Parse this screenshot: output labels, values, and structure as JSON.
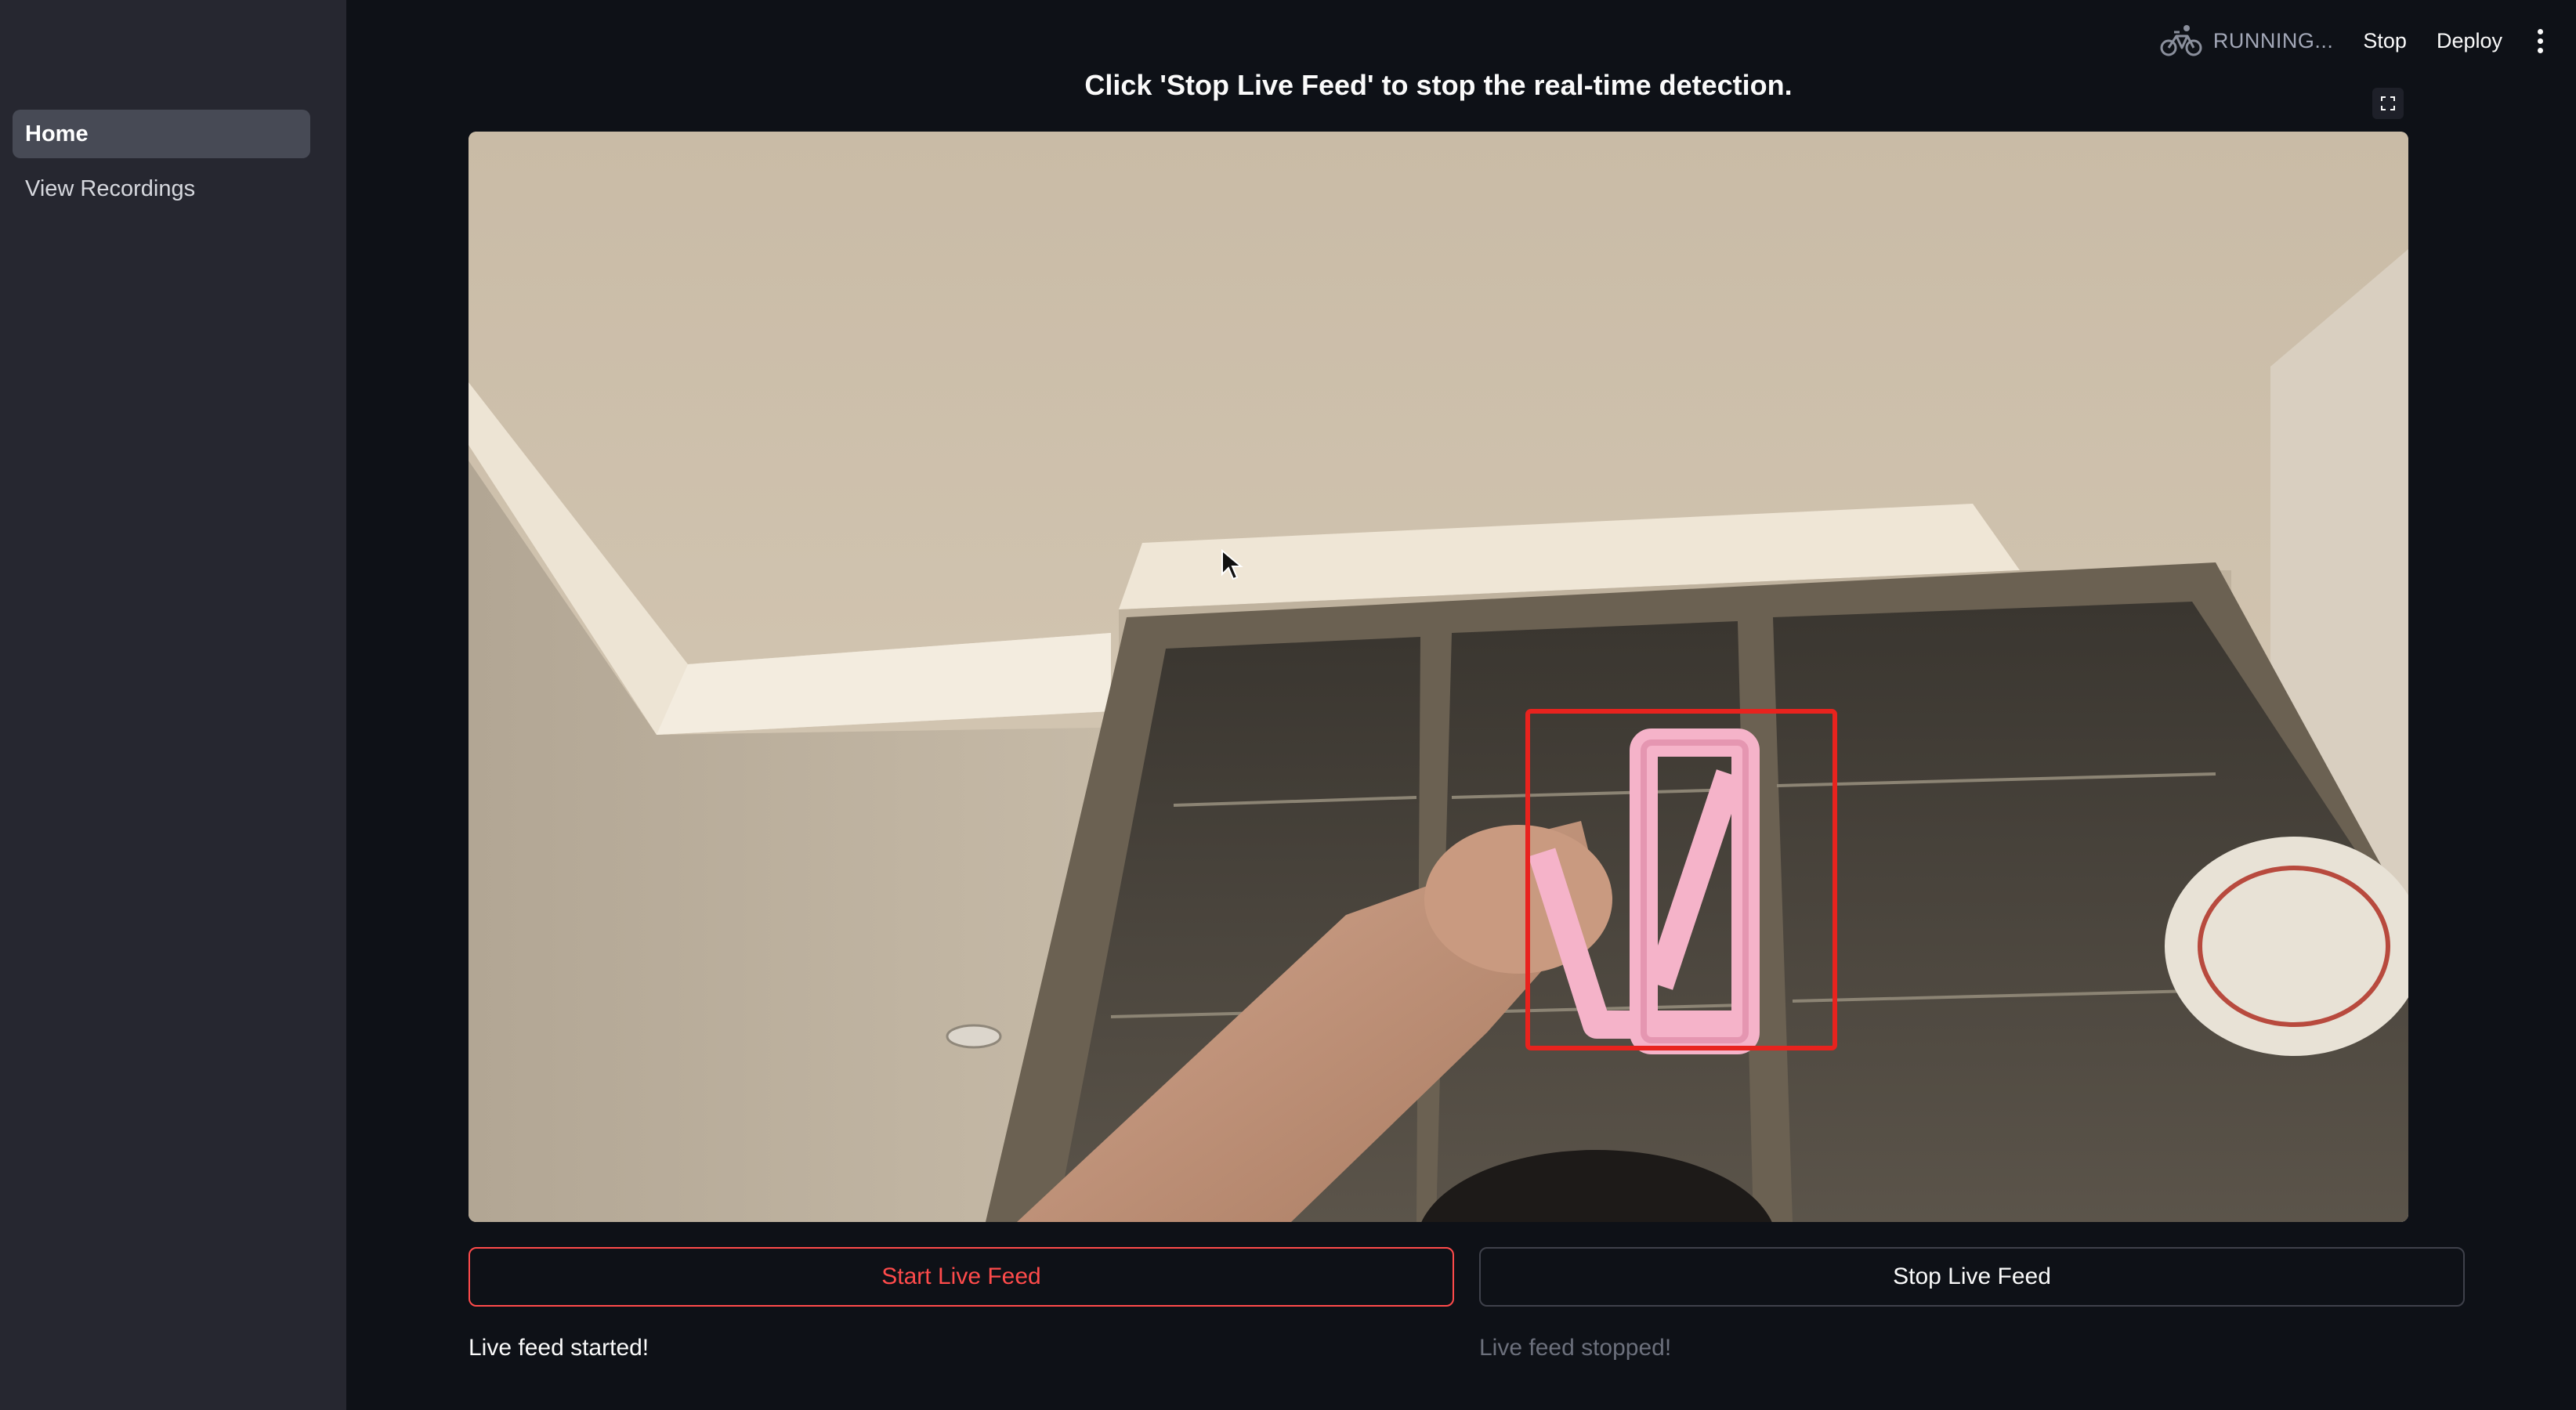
{
  "sidebar": {
    "items": [
      {
        "label": "Home",
        "active": true
      },
      {
        "label": "View Recordings",
        "active": false
      }
    ]
  },
  "header": {
    "status_text": "RUNNING...",
    "stop_label": "Stop",
    "deploy_label": "Deploy"
  },
  "main": {
    "title": "Click 'Stop Live Feed' to stop the real-time detection.",
    "start_button_label": "Start Live Feed",
    "stop_button_label": "Stop Live Feed",
    "start_message": "Live feed started!",
    "stop_message": "Live feed stopped!"
  },
  "colors": {
    "accent": "#ff4b4b",
    "background": "#0e1117",
    "sidebar": "#262730",
    "detection_box": "#e8231e"
  },
  "icons": {
    "status": "bicycle-icon",
    "menu": "vertical-ellipsis-icon",
    "fullscreen": "fullscreen-icon"
  }
}
